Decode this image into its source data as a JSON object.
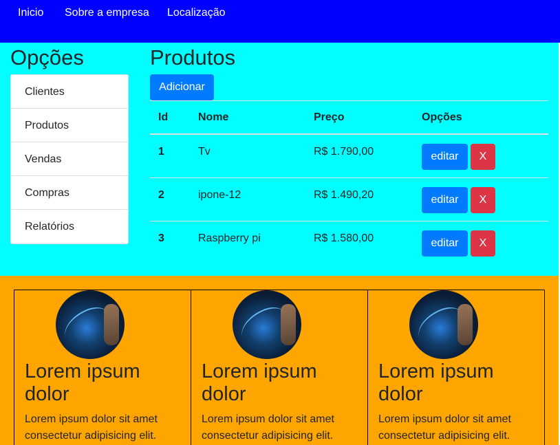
{
  "navbar": {
    "links": [
      "Inicio",
      "Sobre a empresa",
      "Localização"
    ],
    "background": "#0000ff"
  },
  "sidebar": {
    "title": "Opções",
    "items": [
      "Clientes",
      "Produtos",
      "Vendas",
      "Compras",
      "Relatórios"
    ]
  },
  "products": {
    "title": "Produtos",
    "add_label": "Adicionar",
    "headers": {
      "id": "Id",
      "nome": "Nome",
      "preco": "Preço",
      "opcoes": "Opções"
    },
    "rows": [
      {
        "id": "1",
        "nome": "Tv",
        "preco": "R$ 1.790,00"
      },
      {
        "id": "2",
        "nome": "ipone-12",
        "preco": "R$ 1.490,20"
      },
      {
        "id": "3",
        "nome": "Raspberry pi",
        "preco": "R$ 1.580,00"
      }
    ],
    "edit_label": "editar",
    "delete_label": "X"
  },
  "cards": [
    {
      "title": "Lorem ipsum dolor",
      "text": "Lorem ipsum dolor sit amet consectetur adipisicing elit."
    },
    {
      "title": "Lorem ipsum dolor",
      "text": "Lorem ipsum dolor sit amet consectetur adipisicing elit."
    },
    {
      "title": "Lorem ipsum dolor",
      "text": "Lorem ipsum dolor sit amet consectetur adipisicing elit."
    }
  ],
  "colors": {
    "main_bg": "#00ffff",
    "footer_bg": "#ffa500",
    "primary": "#007bff",
    "danger": "#dc3545"
  }
}
